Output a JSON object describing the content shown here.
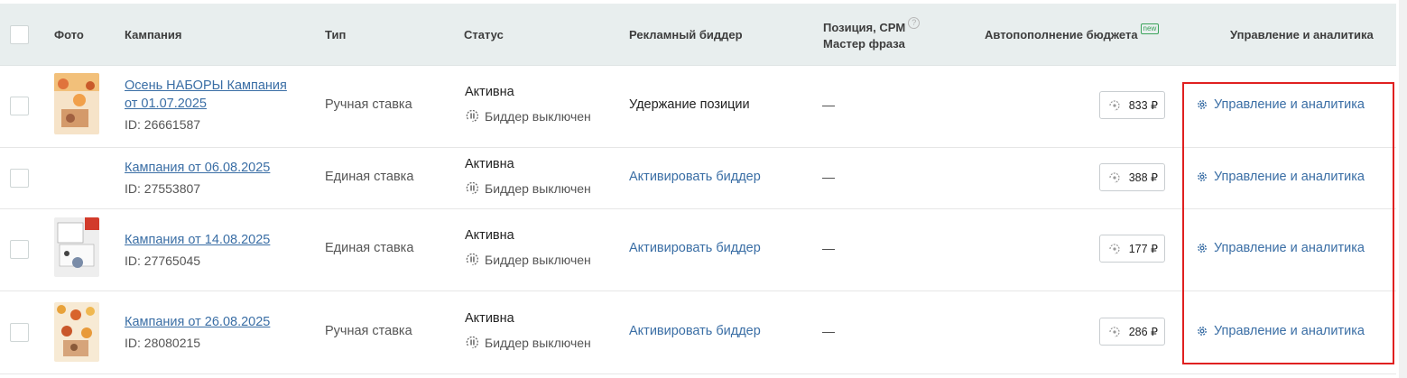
{
  "header": {
    "photo": "Фото",
    "campaign": "Кампания",
    "type": "Тип",
    "status": "Статус",
    "bidder": "Рекламный биддер",
    "position_line1": "Позиция, CPM",
    "position_line2": "Мастер фраза",
    "help_glyph": "?",
    "budget": "Автопополнение бюджета",
    "budget_badge": "new",
    "manage": "Управление и аналитика"
  },
  "rows": [
    {
      "campaign_line1": "Осень НАБОРЫ Кампания",
      "campaign_line2": "от 01.07.2025",
      "id": "ID: 26661587",
      "type": "Ручная ставка",
      "status": "Активна",
      "bidder_status": "Биддер выключен",
      "bidder": "Удержание позиции",
      "position": "—",
      "budget": "833 ₽",
      "manage": "Управление и аналитика"
    },
    {
      "campaign_line1": "Кампания от 06.08.2025",
      "id": "ID: 27553807",
      "type": "Единая ставка",
      "status": "Активна",
      "bidder_status": "Биддер выключен",
      "bidder": "Активировать биддер",
      "position": "—",
      "budget": "388 ₽",
      "manage": "Управление и аналитика"
    },
    {
      "campaign_line1": "Кампания от 14.08.2025",
      "id": "ID: 27765045",
      "type": "Единая ставка",
      "status": "Активна",
      "bidder_status": "Биддер выключен",
      "bidder": "Активировать биддер",
      "position": "—",
      "budget": "177 ₽",
      "manage": "Управление и аналитика"
    },
    {
      "campaign_line1": "Кампания от 26.08.2025",
      "id": "ID: 28080215",
      "type": "Ручная ставка",
      "status": "Активна",
      "bidder_status": "Биддер выключен",
      "bidder": "Активировать биддер",
      "position": "—",
      "budget": "286 ₽",
      "manage": "Управление и аналитика"
    }
  ],
  "colors": {
    "header_bg": "#e8eeee",
    "link": "#3a6ea5",
    "highlight": "#e02020",
    "badge": "#3aa35a"
  }
}
